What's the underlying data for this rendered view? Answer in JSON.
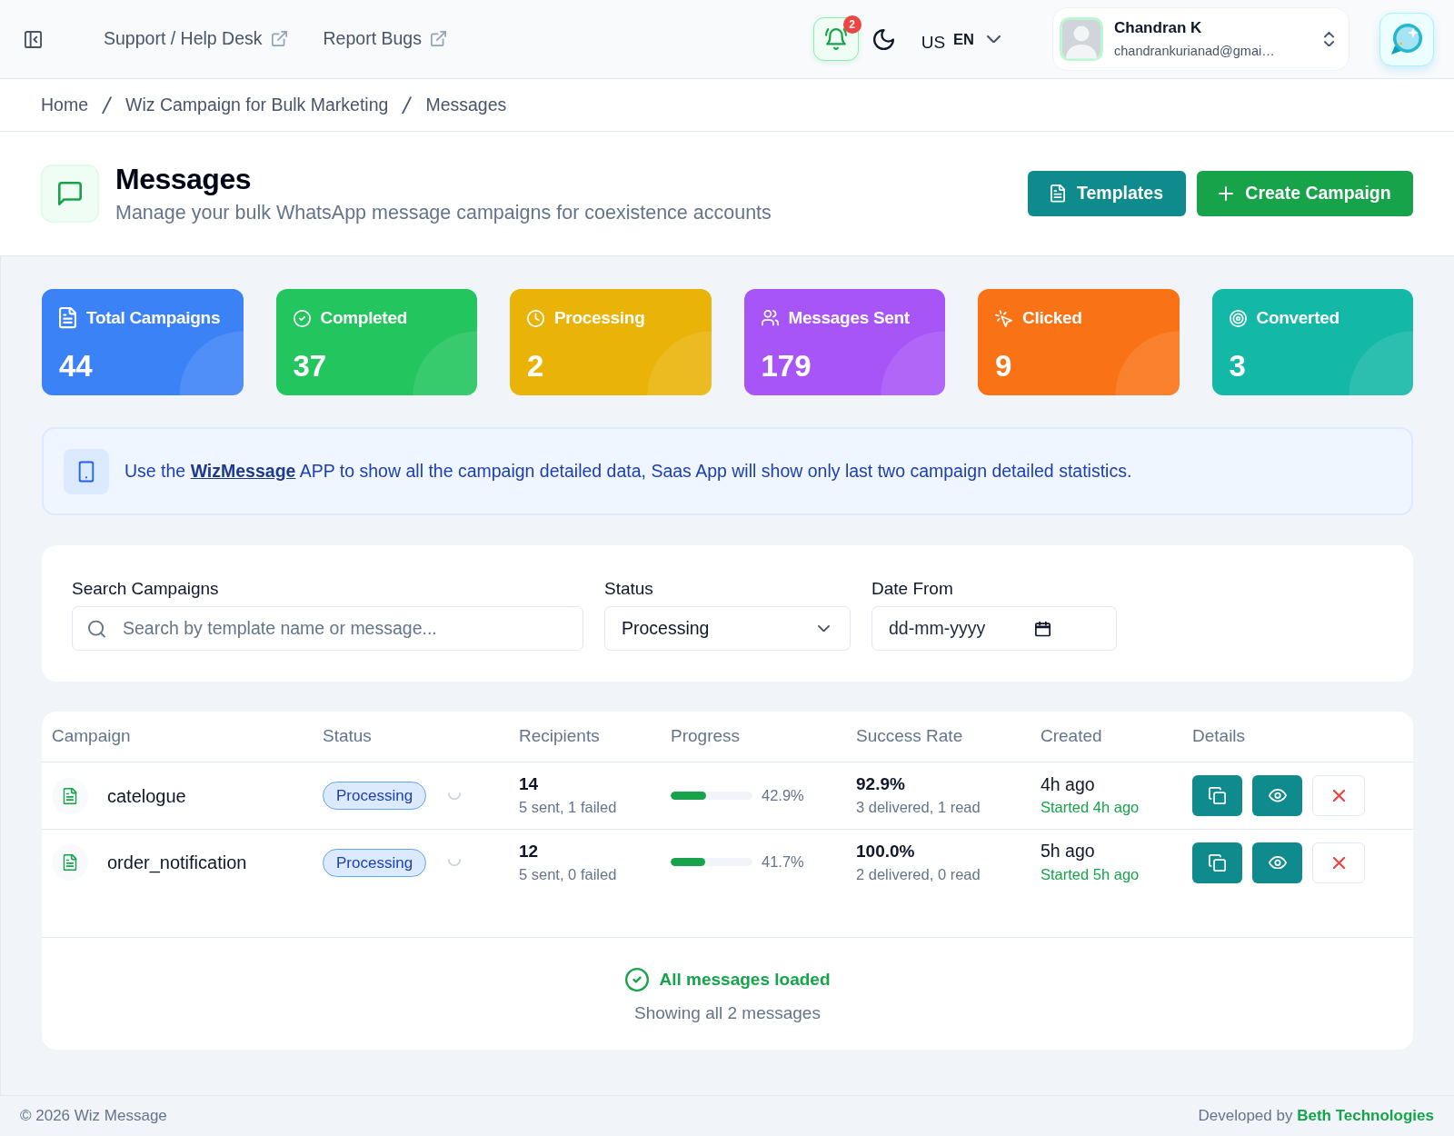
{
  "topbar": {
    "links": [
      {
        "label": "Support / Help Desk"
      },
      {
        "label": "Report Bugs"
      }
    ],
    "notifications": {
      "count": "2"
    },
    "language": {
      "flag": "US",
      "code": "EN"
    },
    "user": {
      "name": "Chandran K",
      "email": "chandrankurianad@gmai…"
    }
  },
  "breadcrumb": [
    {
      "label": "Home"
    },
    {
      "label": "Wiz Campaign for Bulk Marketing"
    },
    {
      "label": "Messages"
    }
  ],
  "header": {
    "title": "Messages",
    "subtitle": "Manage your bulk WhatsApp message campaigns for coexistence accounts",
    "templates_button": "Templates",
    "create_button": "Create Campaign"
  },
  "stats": [
    {
      "label": "Total Campaigns",
      "value": "44",
      "color": "#3b82f6"
    },
    {
      "label": "Completed",
      "value": "37",
      "color": "#22c55e"
    },
    {
      "label": "Processing",
      "value": "2",
      "color": "#eab308"
    },
    {
      "label": "Messages Sent",
      "value": "179",
      "color": "#a855f7"
    },
    {
      "label": "Clicked",
      "value": "9",
      "color": "#f97316"
    },
    {
      "label": "Converted",
      "value": "3",
      "color": "#14b8a6"
    }
  ],
  "notice": {
    "text_before": "Use the",
    "link": "WizMessage",
    "text_after": "APP to show all the campaign detailed data, Saas App will show only last two campaign detailed statistics."
  },
  "filters": {
    "search": {
      "label": "Search Campaigns",
      "placeholder": "Search by template name or message..."
    },
    "status": {
      "label": "Status",
      "value": "Processing"
    },
    "date_from": {
      "label": "Date From",
      "placeholder": "dd-mm-yyyy"
    }
  },
  "table": {
    "columns": [
      "Campaign",
      "Status",
      "Recipients",
      "Progress",
      "Success Rate",
      "Created",
      "Details"
    ],
    "rows": [
      {
        "campaign": "catelogue",
        "status": "Processing",
        "recipients": "14",
        "recipients_detail": "5 sent, 1 failed",
        "progress": {
          "level": 0.429,
          "reading": "42.9%"
        },
        "success_rate": "92.9%",
        "success_detail": "3 delivered, 1 read",
        "created": "4h ago",
        "started": "Started 4h ago"
      },
      {
        "campaign": "order_notification",
        "status": "Processing",
        "recipients": "12",
        "recipients_detail": "5 sent, 0 failed",
        "progress": {
          "level": 0.417,
          "reading": "41.7%"
        },
        "success_rate": "100.0%",
        "success_detail": "2 delivered, 0 read",
        "created": "5h ago",
        "started": "Started 5h ago"
      }
    ],
    "footer": {
      "title": "All messages loaded",
      "subtitle": "Showing all 2 messages"
    }
  },
  "footer": {
    "copyright": "© 2026 Wiz Message",
    "credit": "Developed by",
    "company": "Beth Technologies"
  }
}
